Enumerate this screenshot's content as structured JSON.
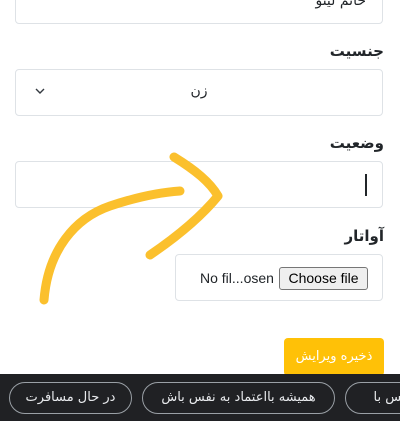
{
  "form": {
    "previous_value": "خانم لیتو",
    "gender_label": "جنسیت",
    "gender_value": "زن",
    "status_label": "وضعیت",
    "status_value": "",
    "avatar_label": "آواتار",
    "file_name_text": "No fil...osen",
    "choose_file_label": "Choose file",
    "save_label": "ذخیره ویرایش"
  },
  "annotation": {
    "arrow_color": "#fbc02d"
  },
  "colors": {
    "accent": "#ffc107",
    "suggestion_bar": "#202124"
  },
  "suggestions": [
    "در حال مسافرت",
    "همیشه بااعتماد به نفس باش",
    "نفس با"
  ]
}
